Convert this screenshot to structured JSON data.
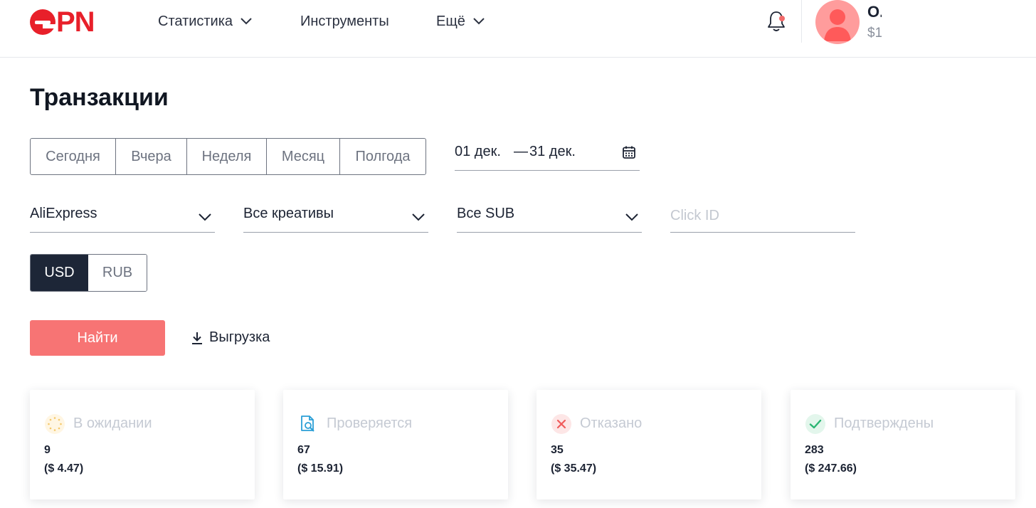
{
  "header": {
    "logo_text": "PN",
    "nav": {
      "statistics": "Статистика",
      "tools": "Инструменты",
      "more": "Ещё"
    },
    "user": {
      "name": "О.",
      "balance": "$1"
    }
  },
  "page": {
    "title": "Транзакции"
  },
  "periods": [
    "Сегодня",
    "Вчера",
    "Неделя",
    "Месяц",
    "Полгода"
  ],
  "date_range": {
    "from": "01 дек.",
    "separator": "—",
    "to": "31 дек."
  },
  "filters": {
    "shop": "AliExpress",
    "creatives": "Все креативы",
    "sub": "Все SUB",
    "click_id_placeholder": "Click ID"
  },
  "currency": {
    "options": [
      "USD",
      "RUB"
    ],
    "selected": "USD"
  },
  "actions": {
    "find": "Найти",
    "export": "Выгрузка"
  },
  "status_cards": [
    {
      "label": "В ожидании",
      "count": "9",
      "sum": "($ 4.47)",
      "icon": "pending-spinner-icon",
      "color": "#f5b73b"
    },
    {
      "label": "Проверяется",
      "count": "67",
      "sum": "($ 15.91)",
      "icon": "document-search-icon",
      "color": "#2a9fd6"
    },
    {
      "label": "Отказано",
      "count": "35",
      "sum": "($ 35.47)",
      "icon": "cross-icon",
      "color": "#f05b5b"
    },
    {
      "label": "Подтверждены",
      "count": "283",
      "sum": "($ 247.66)",
      "icon": "check-icon",
      "color": "#2bb673"
    }
  ],
  "colors": {
    "brand": "#e8202a",
    "primary_button": "#f77474",
    "dark": "#1d2637"
  }
}
